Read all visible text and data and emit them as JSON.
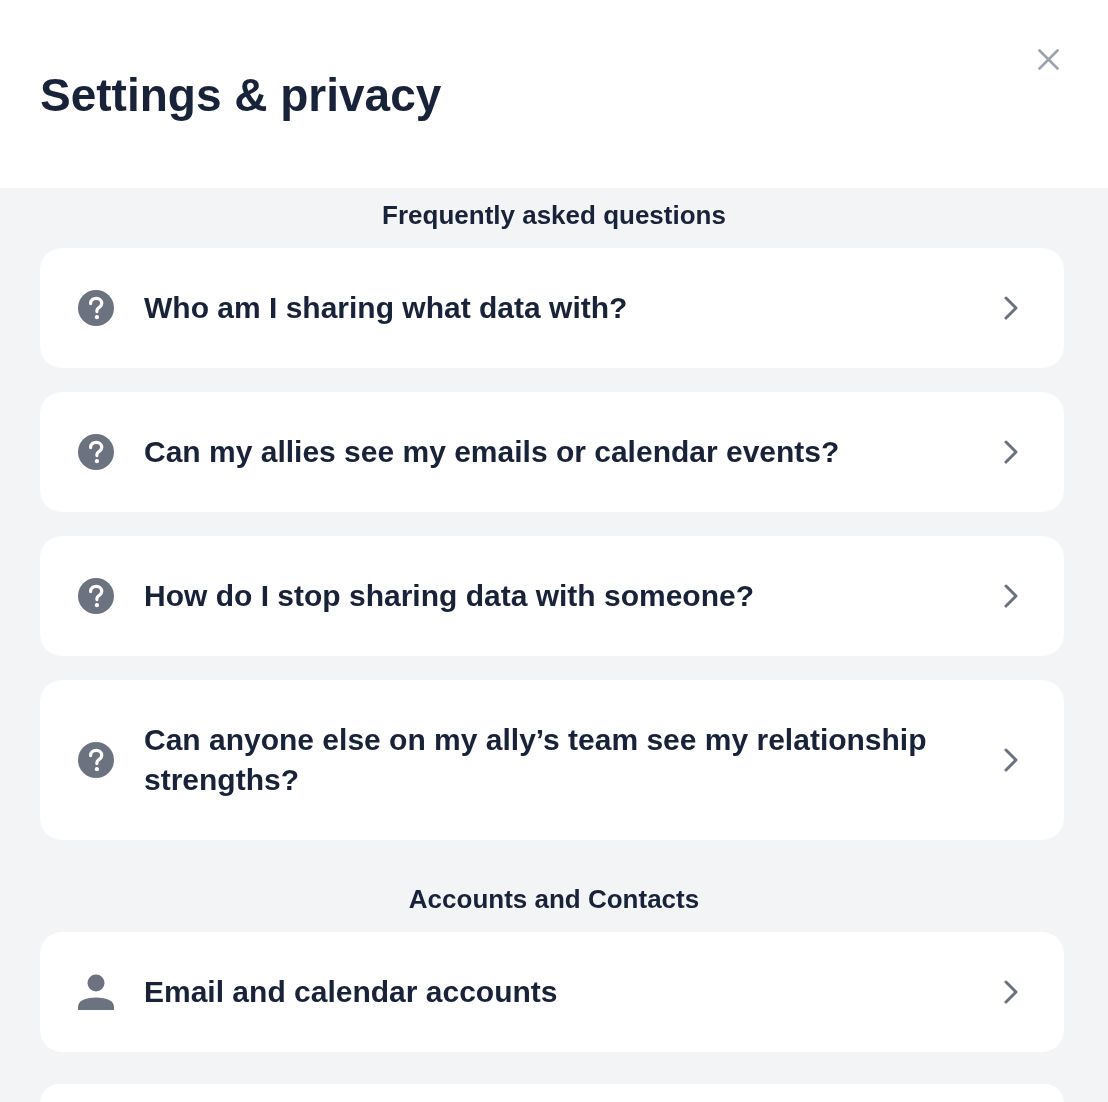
{
  "header": {
    "title": "Settings & privacy"
  },
  "sections": [
    {
      "heading": "Frequently asked questions",
      "items": [
        {
          "kind": "question",
          "label": "Who am I sharing what data with?"
        },
        {
          "kind": "question",
          "label": "Can my allies see my emails or calendar events?"
        },
        {
          "kind": "question",
          "label": "How do I stop sharing data with someone?"
        },
        {
          "kind": "question",
          "label": "Can anyone else on my ally’s team see my relationship strengths?"
        }
      ]
    },
    {
      "heading": "Accounts and Contacts",
      "items": [
        {
          "kind": "account",
          "label": "Email and calendar accounts"
        },
        {
          "kind": "clipped"
        }
      ]
    }
  ]
}
